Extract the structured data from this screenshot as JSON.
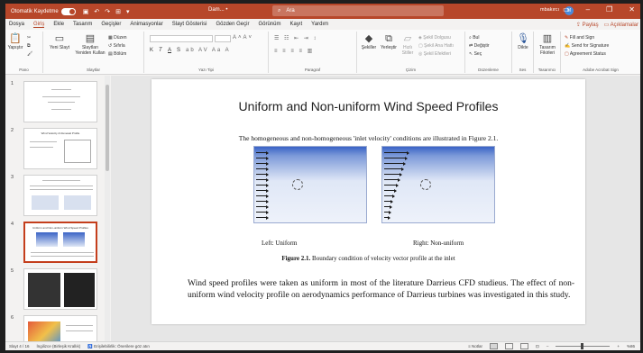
{
  "titlebar": {
    "autosave_label": "Otomatik Kaydetme",
    "doc_title": "Dam... •",
    "search_placeholder": "Ara",
    "user_name": "mbakırcı",
    "user_initials": "M"
  },
  "tabs": [
    "Dosya",
    "Giriş",
    "Ekle",
    "Tasarım",
    "Geçişler",
    "Animasyonlar",
    "Slayt Gösterisi",
    "Gözden Geçir",
    "Görünüm",
    "Kayıt",
    "Yardım"
  ],
  "active_tab": "Giriş",
  "share_label": "Paylaş",
  "comments_label": "Açıklamalar",
  "ribbon": {
    "clipboard": {
      "paste": "Yapıştır",
      "label": "Pano"
    },
    "slides": {
      "new_slide": "Yeni Slayt",
      "reuse_slides": "Slaytları Yeniden Kullan",
      "layout": "Düzen",
      "reset": "Sıfırla",
      "section": "Bölüm",
      "label": "Slaytlar"
    },
    "font": {
      "label": "Yazı Tipi",
      "bold": "K",
      "italic": "T",
      "underline": "A",
      "strike": "S"
    },
    "paragraph": {
      "label": "Paragraf"
    },
    "drawing": {
      "shapes": "Şekiller",
      "arrange": "Yerleştir",
      "quick_styles": "Hızlı Stiller",
      "fill": "Şekil Dolgusu",
      "outline": "Şekil Ana Hattı",
      "effects": "Şekil Efektleri",
      "label": "Çizim"
    },
    "editing": {
      "find": "Bul",
      "replace": "Değiştir",
      "select": "Seç",
      "label": "Düzenleme"
    },
    "voice": {
      "dictate": "Dikte",
      "label": "Ses"
    },
    "designer": {
      "designer": "Tasarım Fikirleri",
      "label": "Tasarımcı"
    },
    "acrobat": {
      "fill_sign": "Fill and Sign",
      "send_signature": "Send for Signature",
      "agreement": "Agreement Status",
      "label": "Adobe Acrobat Sign"
    }
  },
  "thumbnails": [
    {
      "num": "1",
      "title": ""
    },
    {
      "num": "2",
      "title": "Wind Velocity & Renewal Profile"
    },
    {
      "num": "3",
      "title": ""
    },
    {
      "num": "4",
      "title": "Uniform and Non-uniform Wind Speed Profiles"
    },
    {
      "num": "5",
      "title": ""
    },
    {
      "num": "6",
      "title": ""
    }
  ],
  "selected_slide": "4",
  "slide": {
    "title": "Uniform and Non-uniform Wind Speed Profiles",
    "intro": "The homogeneous and non-homogeneous 'inlet velocity' conditions are illustrated in Figure 2.1.",
    "left_label": "Left: Uniform",
    "right_label": "Right: Non-uniform",
    "fig_number": "Figure 2.1.",
    "fig_text": "Boundary condition of velocity vector profile at the inlet",
    "body": "Wind speed profiles were taken as uniform in most of the literature Darrieus CFD studieus. The effect of non-uniform wind velocity profile on aerodynamics performance of Darrieus turbines was investigated in this study."
  },
  "status": {
    "slide_info": "Slayt 4 / 16",
    "language": "İngilizce (Birleşik Krallık)",
    "accessibility": "Erişilebilirlik: Önerilere göz atın",
    "notes": "Notlar",
    "zoom": "%86"
  },
  "colors": {
    "accent": "#b7472a",
    "selection": "#c43e1c",
    "inlet_blue": "#3a63c6"
  }
}
